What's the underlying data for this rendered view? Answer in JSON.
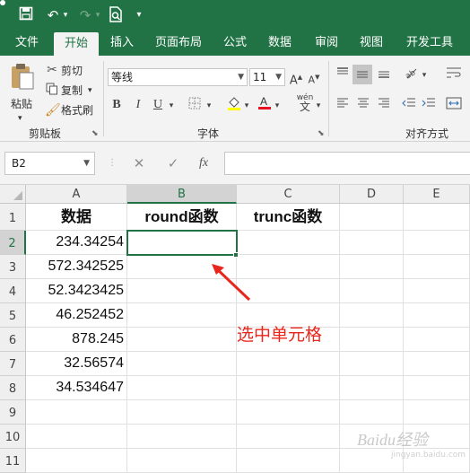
{
  "tabs": [
    "文件",
    "开始",
    "插入",
    "页面布局",
    "公式",
    "数据",
    "审阅",
    "视图",
    "开发工具"
  ],
  "active_tab": "开始",
  "ribbon": {
    "clipboard": {
      "paste": "粘贴",
      "cut": "剪切",
      "copy": "复制",
      "format_painter": "格式刷",
      "group_label": "剪贴板"
    },
    "font": {
      "font_name": "等线",
      "font_size": "11",
      "bold": "B",
      "italic": "I",
      "underline": "U",
      "wen": "wén",
      "group_label": "字体"
    },
    "alignment": {
      "group_label": "对齐方式"
    }
  },
  "formula_bar": {
    "name_box": "B2",
    "cancel": "✕",
    "enter": "✓",
    "fx": "fx",
    "formula": ""
  },
  "sheet": {
    "columns": [
      "A",
      "B",
      "C",
      "D",
      "E"
    ],
    "selected_column": "B",
    "rows": [
      "1",
      "2",
      "3",
      "4",
      "5",
      "6",
      "7",
      "8",
      "9",
      "10",
      "11"
    ],
    "selected_row": "2",
    "headers": {
      "A1": "数据",
      "B1": "round函数",
      "C1": "trunc函数"
    },
    "values": [
      "234.34254",
      "572.342525",
      "52.3423425",
      "46.252452",
      "878.245",
      "32.56574",
      "34.534647"
    ]
  },
  "annotation": {
    "text": "选中单元格",
    "color": "#e8261b"
  },
  "watermark": {
    "text": "Baidu经验",
    "sub": "jingyan.baidu.com"
  },
  "colors": {
    "excel_green": "#217346",
    "ribbon_bg": "#f3f3f3"
  }
}
